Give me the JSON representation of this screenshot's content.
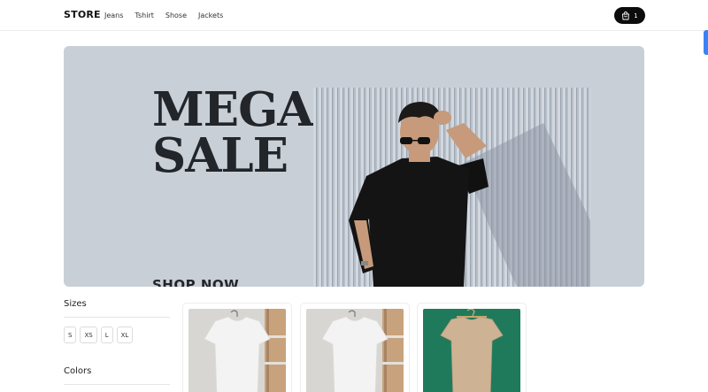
{
  "nav": {
    "logo": "STORE",
    "links": [
      "Jeans",
      "Tshirt",
      "Shose",
      "Jackets"
    ],
    "cart_count": "1"
  },
  "hero": {
    "title": "MEGA\nSALE",
    "cta": "SHOP NOW"
  },
  "filters": {
    "sizes_heading": "Sizes",
    "sizes": [
      "S",
      "XS",
      "L",
      "XL"
    ],
    "colors_heading": "Colors"
  },
  "colors": {
    "accent": "#0c0c0c",
    "hero_bg": "#c9cfd6",
    "scroll_handle": "#3b82f6"
  },
  "products": [
    {
      "image": "white t-shirt on hanger",
      "icon": "tshirt-white"
    },
    {
      "image": "white t-shirt on hanger",
      "icon": "tshirt-white"
    },
    {
      "image": "beige t-shirt on green background",
      "icon": "tshirt-beige"
    }
  ]
}
